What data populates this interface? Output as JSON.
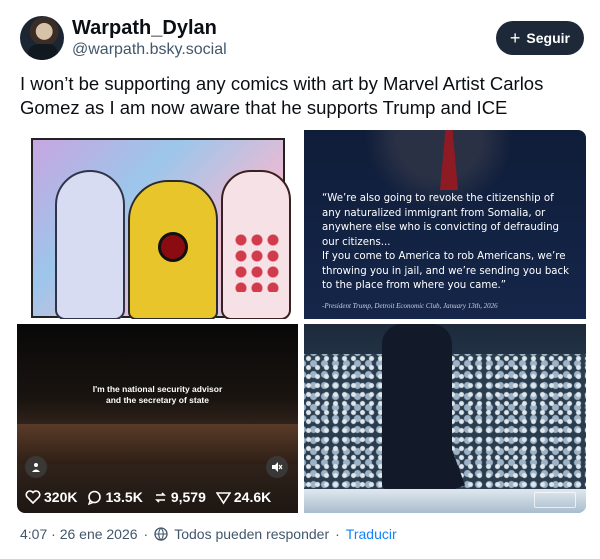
{
  "author": {
    "display_name": "Warpath_Dylan",
    "handle": "@warpath.bsky.social"
  },
  "follow_button": {
    "label": "Seguir"
  },
  "post": {
    "text": "I won’t be supporting any comics with art by Marvel Artist Carlos Gomez as I am now aware that he supports Trump and ICE"
  },
  "images": {
    "quote": {
      "paragraph1": "“We’re also going to revoke the citizenship of any naturalized immigrant from Somalia, or anywhere else who is convicting of defrauding our citizens...",
      "paragraph2": "If you come to America to rob Americans, we’re throwing you in jail, and we’re sending you back to the place from where you came.”",
      "attribution": "-President Trump, Detroit Economic Club, January 13th, 2026"
    },
    "video": {
      "caption_line1": "I'm the national security advisor",
      "caption_line2": "and the secretary of state",
      "person_icon": "person-icon",
      "mute_icon": "mute-icon"
    }
  },
  "stats": {
    "likes": "320K",
    "replies": "13.5K",
    "reposts": "9,579",
    "views": "24.6K"
  },
  "footer": {
    "timestamp": "4:07 · 26 ene 2026",
    "separator": "·",
    "reply_setting": "Todos pueden responder",
    "translate": "Traducir"
  },
  "colors": {
    "accent": "#1083fe",
    "button_bg": "#1d2939",
    "muted_text": "#42576c"
  }
}
